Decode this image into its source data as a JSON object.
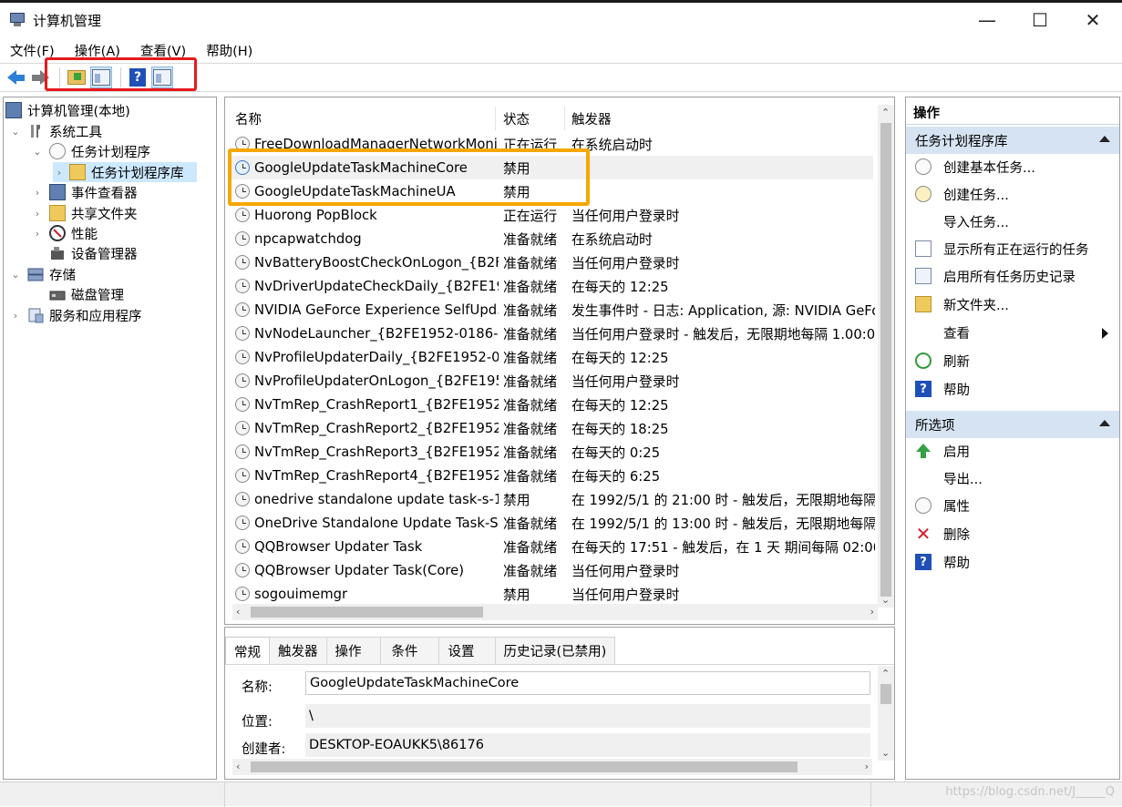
{
  "window": {
    "title": "计算机管理",
    "minimize": "—",
    "maximize": "☐",
    "close": "✕"
  },
  "menu": [
    "文件(F)",
    "操作(A)",
    "查看(V)",
    "帮助(H)"
  ],
  "tree": {
    "root": "计算机管理(本地)",
    "system_tools": "系统工具",
    "task_scheduler": "任务计划程序",
    "task_library": "任务计划程序库",
    "event_viewer": "事件查看器",
    "shared_folders": "共享文件夹",
    "performance": "性能",
    "device_manager": "设备管理器",
    "storage": "存储",
    "disk_management": "磁盘管理",
    "services_apps": "服务和应用程序"
  },
  "tasks": {
    "columns": {
      "name": "名称",
      "status": "状态",
      "trigger": "触发器"
    },
    "rows": [
      {
        "name": "FreeDownloadManagerNetworkMoni...",
        "status": "正在运行",
        "trigger": "在系统启动时"
      },
      {
        "name": "GoogleUpdateTaskMachineCore",
        "status": "禁用",
        "trigger": ""
      },
      {
        "name": "GoogleUpdateTaskMachineUA",
        "status": "禁用",
        "trigger": ""
      },
      {
        "name": "Huorong PopBlock",
        "status": "正在运行",
        "trigger": "当任何用户登录时"
      },
      {
        "name": "npcapwatchdog",
        "status": "准备就绪",
        "trigger": "在系统启动时"
      },
      {
        "name": "NvBatteryBoostCheckOnLogon_{B2F...",
        "status": "准备就绪",
        "trigger": "当任何用户登录时"
      },
      {
        "name": "NvDriverUpdateCheckDaily_{B2FE19...",
        "status": "准备就绪",
        "trigger": "在每天的 12:25"
      },
      {
        "name": "NVIDIA GeForce Experience SelfUpd...",
        "status": "准备就绪",
        "trigger": "发生事件时 - 日志: Application, 源: NVIDIA GeFo"
      },
      {
        "name": "NvNodeLauncher_{B2FE1952-0186-...",
        "status": "准备就绪",
        "trigger": "当任何用户登录时 - 触发后，无限期地每隔 1.00:0"
      },
      {
        "name": "NvProfileUpdaterDaily_{B2FE1952-0...",
        "status": "准备就绪",
        "trigger": "在每天的 12:25"
      },
      {
        "name": "NvProfileUpdaterOnLogon_{B2FE195...",
        "status": "准备就绪",
        "trigger": "当任何用户登录时"
      },
      {
        "name": "NvTmRep_CrashReport1_{B2FE1952...",
        "status": "准备就绪",
        "trigger": "在每天的 12:25"
      },
      {
        "name": "NvTmRep_CrashReport2_{B2FE1952...",
        "status": "准备就绪",
        "trigger": "在每天的 18:25"
      },
      {
        "name": "NvTmRep_CrashReport3_{B2FE1952...",
        "status": "准备就绪",
        "trigger": "在每天的 0:25"
      },
      {
        "name": "NvTmRep_CrashReport4_{B2FE1952...",
        "status": "准备就绪",
        "trigger": "在每天的 6:25"
      },
      {
        "name": "onedrive standalone update task-s-1-...",
        "status": "禁用",
        "trigger": "在 1992/5/1 的 21:00 时 - 触发后，无限期地每隔"
      },
      {
        "name": "OneDrive Standalone Update Task-S...",
        "status": "准备就绪",
        "trigger": "在 1992/5/1 的 13:00 时 - 触发后，无限期地每隔"
      },
      {
        "name": "QQBrowser Updater Task",
        "status": "准备就绪",
        "trigger": "在每天的 17:51 - 触发后，在 1 天 期间每隔 02:00:"
      },
      {
        "name": "QQBrowser Updater Task(Core)",
        "status": "准备就绪",
        "trigger": "当任何用户登录时"
      },
      {
        "name": "sogouimemgr",
        "status": "禁用",
        "trigger": "当任何用户登录时"
      }
    ]
  },
  "details": {
    "tabs": [
      "常规",
      "触发器",
      "操作",
      "条件",
      "设置",
      "历史记录(已禁用)"
    ],
    "name_label": "名称:",
    "name_value": "GoogleUpdateTaskMachineCore",
    "location_label": "位置:",
    "location_value": "\\",
    "author_label": "创建者:",
    "author_value": "DESKTOP-EOAUKK5\\86176"
  },
  "actions": {
    "header": "操作",
    "group1": "任务计划程序库",
    "items1": [
      "创建基本任务...",
      "创建任务...",
      "导入任务...",
      "显示所有正在运行的任务",
      "启用所有任务历史记录",
      "新文件夹...",
      "查看",
      "刷新",
      "帮助"
    ],
    "group2": "所选项",
    "items2": [
      "启用",
      "导出...",
      "属性",
      "删除",
      "帮助"
    ]
  },
  "statusbar": {
    "watermark": "https://blog.csdn.net/J_____Q"
  },
  "colors": {
    "selection_highlight_red": "#e8191d",
    "annotation_orange": "#f5a800",
    "action_group_bg": "#d6e3f2"
  }
}
